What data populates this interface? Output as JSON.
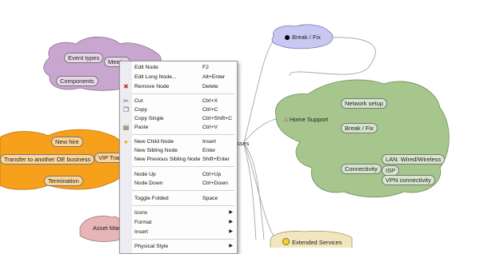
{
  "mindmap": {
    "center_partial": "sses",
    "nodes": {
      "event_types": "Event types",
      "meeting": "Meetin",
      "components": "Components",
      "new_hire": "New hire",
      "transfer": "Transfer to another OE business",
      "vip": "VIP Tran",
      "termination": "Termination",
      "asset": "Asset Mana",
      "break_fix_top": "Break / Fix",
      "home_support": "Home Support",
      "network_setup": "Network setup",
      "break_fix_inner": "Break / Fix",
      "connectivity": "Connectivity",
      "lan": "LAN: Wired/Wireless",
      "isp": "ISP",
      "vpn": "VPN connectivity",
      "extended": "Extended Services"
    }
  },
  "context_menu": {
    "items": [
      {
        "label": "Edit Node",
        "shortcut": "F2",
        "icon": ""
      },
      {
        "label": "Edit Long Node...",
        "shortcut": "Alt+Enter",
        "icon": ""
      },
      {
        "label": "Remove Node",
        "shortcut": "Delete",
        "icon": "remove-icon"
      },
      {
        "label": "Cut",
        "shortcut": "Ctrl+X",
        "icon": "scissors-icon"
      },
      {
        "label": "Copy",
        "shortcut": "Ctrl+C",
        "icon": "copy-icon"
      },
      {
        "label": "Copy Single",
        "shortcut": "Ctrl+Shift+C",
        "icon": ""
      },
      {
        "label": "Paste",
        "shortcut": "Ctrl+V",
        "icon": "paste-icon"
      },
      {
        "label": "New Child Node",
        "shortcut": "Insert",
        "icon": "bulb-icon"
      },
      {
        "label": "New Sibling Node",
        "shortcut": "Enter",
        "icon": ""
      },
      {
        "label": "New Previous Sibling Node",
        "shortcut": "Shift+Enter",
        "icon": ""
      },
      {
        "label": "Node Up",
        "shortcut": "Ctrl+Up",
        "icon": ""
      },
      {
        "label": "Node Down",
        "shortcut": "Ctrl+Down",
        "icon": ""
      },
      {
        "label": "Toggle Folded",
        "shortcut": "Space",
        "icon": ""
      },
      {
        "label": "Icons",
        "shortcut": "",
        "icon": "",
        "submenu": true
      },
      {
        "label": "Format",
        "shortcut": "",
        "icon": "",
        "submenu": true
      },
      {
        "label": "Insert",
        "shortcut": "",
        "icon": "",
        "submenu": true
      },
      {
        "label": "Physical Style",
        "shortcut": "",
        "icon": "",
        "submenu": true
      }
    ]
  },
  "colors": {
    "purple_cloud": "#c9a6cf",
    "orange_cloud": "#f7a01c",
    "green_cloud": "#a7c68e",
    "blue_cloud": "#c8c8f2",
    "pink_cloud": "#e7b5b5",
    "yellow_cloud": "#f2e6bf"
  }
}
